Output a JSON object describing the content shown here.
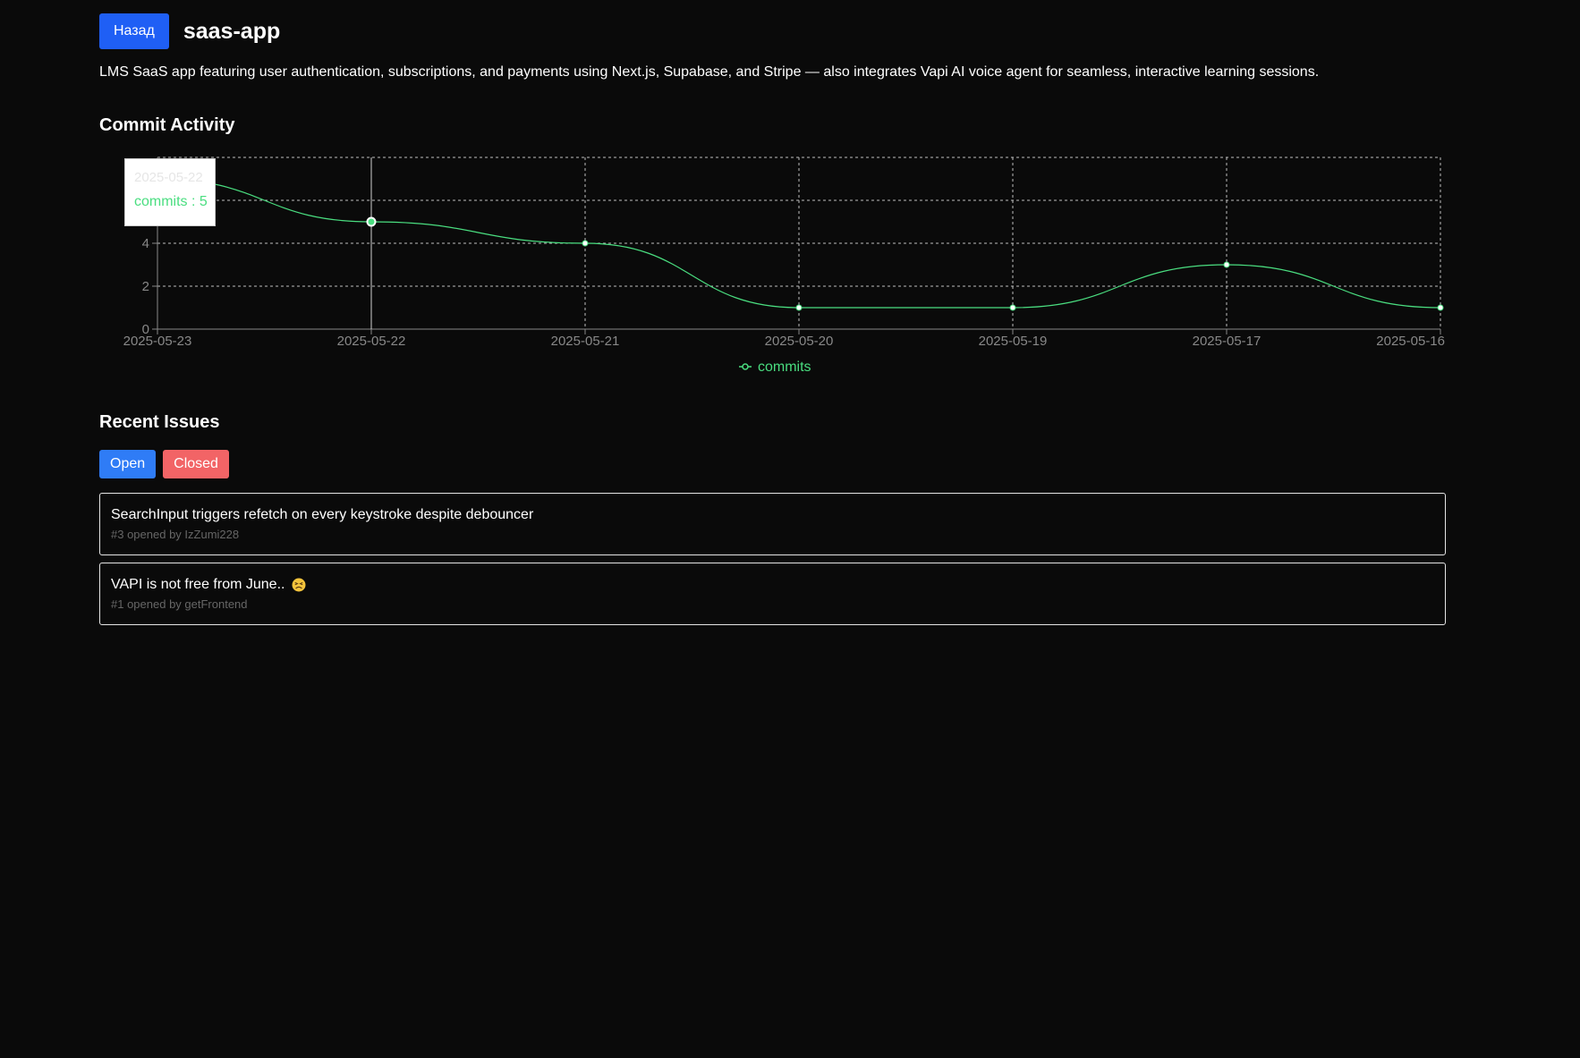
{
  "header": {
    "back_label": "Назад",
    "repo_name": "saas-app"
  },
  "description": "LMS SaaS app featuring user authentication, subscriptions, and payments using Next.js, Supabase, and Stripe — also integrates Vapi AI voice agent for seamless, interactive learning sessions.",
  "commit_section": {
    "title": "Commit Activity"
  },
  "chart_data": {
    "type": "line",
    "x": [
      "2025-05-23",
      "2025-05-22",
      "2025-05-21",
      "2025-05-20",
      "2025-05-19",
      "2025-05-17",
      "2025-05-16"
    ],
    "series": [
      {
        "name": "commits",
        "values": [
          7,
          5,
          4,
          1,
          1,
          3,
          1
        ]
      }
    ],
    "y_ticks": [
      0,
      2,
      4
    ],
    "ylim": [
      0,
      8
    ],
    "grid": true,
    "legend": "bottom-center",
    "line_color": "#4ade80",
    "tooltip": {
      "label": "2025-05-22",
      "value_text": "commits : 5"
    }
  },
  "issues_section": {
    "title": "Recent Issues",
    "filters": [
      {
        "label": "Open",
        "color": "#2f7cf6"
      },
      {
        "label": "Closed",
        "color": "#f26466"
      }
    ],
    "issues": [
      {
        "title": "SearchInput triggers refetch on every keystroke despite debouncer",
        "meta": "#3 opened by IzZumi228",
        "emoji": ""
      },
      {
        "title": "VAPI is not free from June.. ",
        "meta": "#1 opened by getFrontend",
        "emoji": "persevering-face-icon"
      }
    ]
  }
}
